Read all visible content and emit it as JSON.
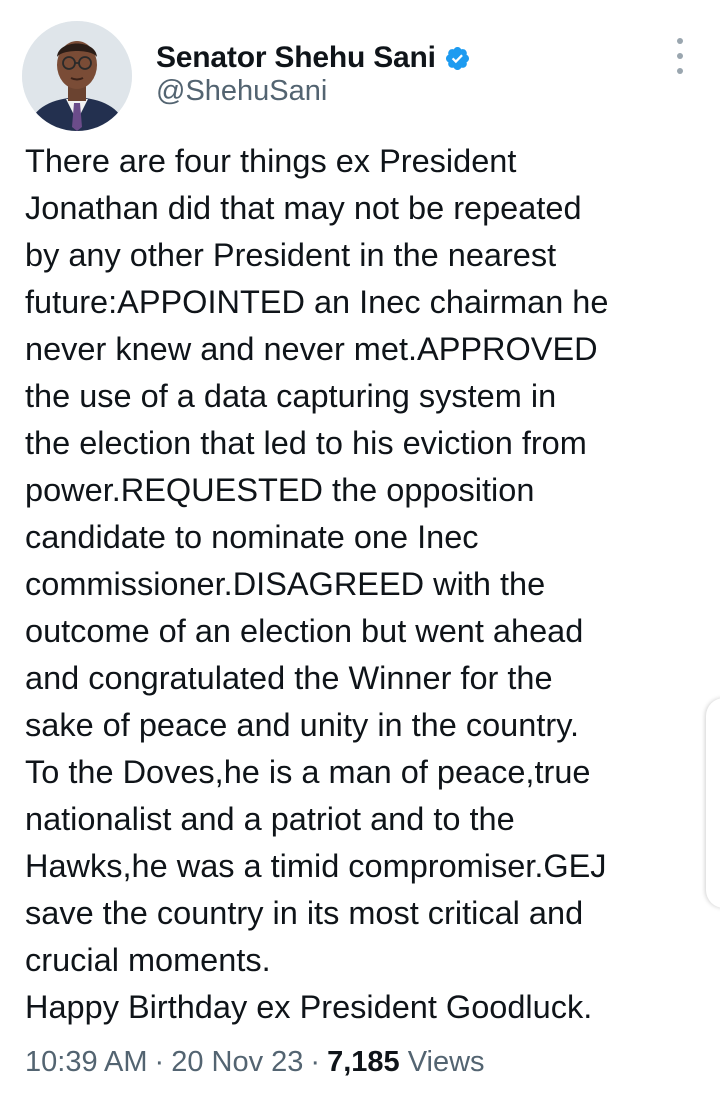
{
  "author": {
    "display_name": "Senator Shehu Sani",
    "handle": "@ShehuSani",
    "verified": true,
    "verified_color": "#1d9bf0"
  },
  "menu_icon": "more-vertical-icon",
  "tweet": {
    "lines": [
      "There are four things ex President",
      "Jonathan did that may not be repeated",
      "by any other President in the nearest",
      "future:APPOINTED an Inec chairman he",
      "never knew and never met.APPROVED",
      "the use of a data capturing system in",
      "the election that led to his eviction from",
      "power.REQUESTED the opposition",
      "candidate to nominate one Inec",
      "commissioner.DISAGREED with the",
      "outcome of an election but went ahead",
      "and congratulated the Winner for the",
      "sake of peace and unity in the country.",
      "To the Doves,he is a man of peace,true",
      "nationalist and a patriot and to the",
      "Hawks,he was a timid compromiser.GEJ",
      "save the country in its most critical and",
      "crucial moments.",
      "Happy Birthday ex President Goodluck."
    ]
  },
  "meta": {
    "time": "10:39 AM",
    "separator": "·",
    "date": "20 Nov 23",
    "views_count": "7,185",
    "views_label": "Views"
  }
}
